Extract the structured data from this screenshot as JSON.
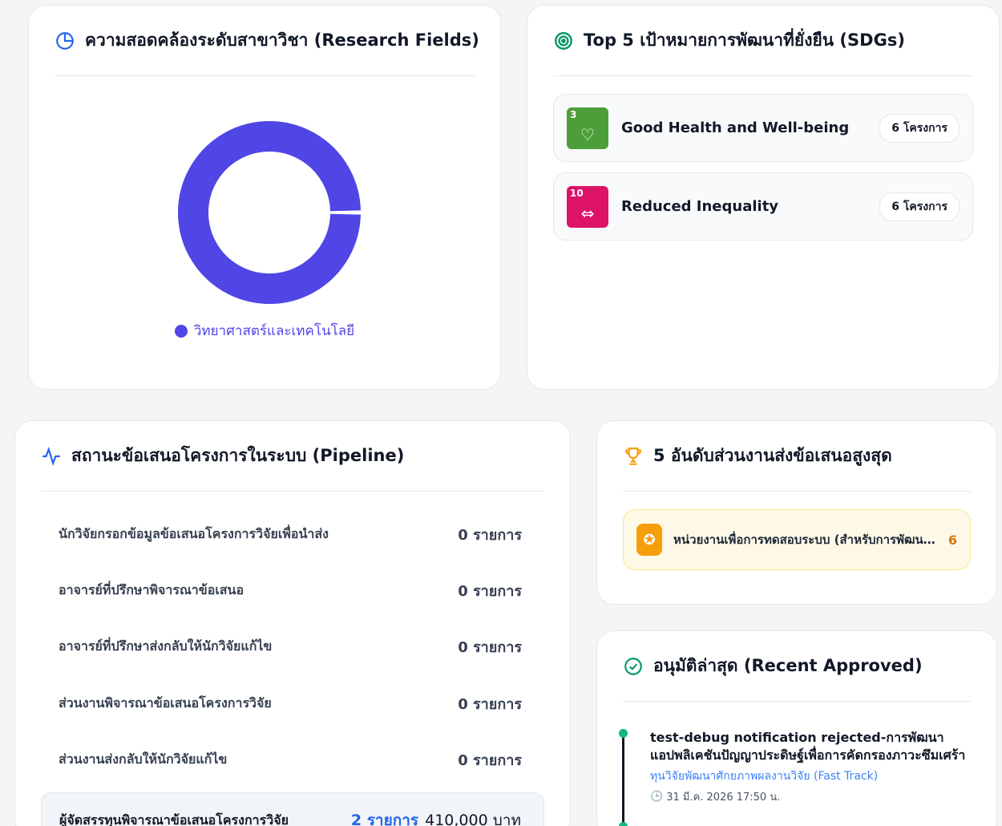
{
  "fields_card": {
    "title": "ความสอดคล้องระดับสาขาวิชา (Research Fields)",
    "legend": [
      "วิทยาศาสตร์และเทคโนโลยี"
    ]
  },
  "chart_data": {
    "type": "pie",
    "categories": [
      "วิทยาศาสตร์และเทคโนโลยี"
    ],
    "values": [
      1
    ],
    "colors": [
      "#4f46e5"
    ]
  },
  "sdg_card": {
    "title": "Top 5 เป้าหมายการพัฒนาที่ยั่งยืน (SDGs)",
    "items": [
      {
        "num": "3",
        "name": "Good Health and Well-being",
        "count": "6 โครงการ",
        "color": "#4c9f38"
      },
      {
        "num": "10",
        "name": "Reduced Inequality",
        "count": "6 โครงการ",
        "color": "#dd1367"
      }
    ]
  },
  "pipeline_card": {
    "title": "สถานะข้อเสนอโครงการในระบบ (Pipeline)",
    "rows": [
      {
        "label": "นักวิจัยกรอกข้อมูลข้อเสนอโครงการวิจัยเพื่อนำส่ง",
        "count": "0 รายการ"
      },
      {
        "label": "อาจารย์ที่ปรึกษาพิจารณาข้อเสนอ",
        "count": "0 รายการ"
      },
      {
        "label": "อาจารย์ที่ปรึกษาส่งกลับให้นักวิจัยแก้ไข",
        "count": "0 รายการ"
      },
      {
        "label": "ส่วนงานพิจารณาข้อเสนอโครงการวิจัย",
        "count": "0 รายการ"
      },
      {
        "label": "ส่วนงานส่งกลับให้นักวิจัยแก้ไข",
        "count": "0 รายการ"
      }
    ],
    "highlight": {
      "label": "ผู้จัดสรรทุนพิจารณาข้อเสนอโครงการวิจัย",
      "count": "2 รายการ",
      "amount": "410,000 บาท"
    }
  },
  "top_card": {
    "title": "5 อันดับส่วนงานส่งข้อเสนอสูงสุด",
    "items": [
      {
        "name": "หน่วยงานเพื่อการทดสอบระบบ (สำหรับการพัฒนาระบบ)",
        "count": "6"
      }
    ]
  },
  "recent_card": {
    "title": "อนุมัติล่าสุด (Recent Approved)",
    "items": [
      {
        "title": "test-debug notification rejected-การพัฒนาแอปพลิเคชันปัญญาประดิษฐ์เพื่อการคัดกรองภาวะซึมเศร้า",
        "fund": "ทุนวิจัยพัฒนาศักยภาพผลงานวิจัย (Fast Track)",
        "time": "31 มี.ค. 2026 17:50 น."
      }
    ]
  }
}
